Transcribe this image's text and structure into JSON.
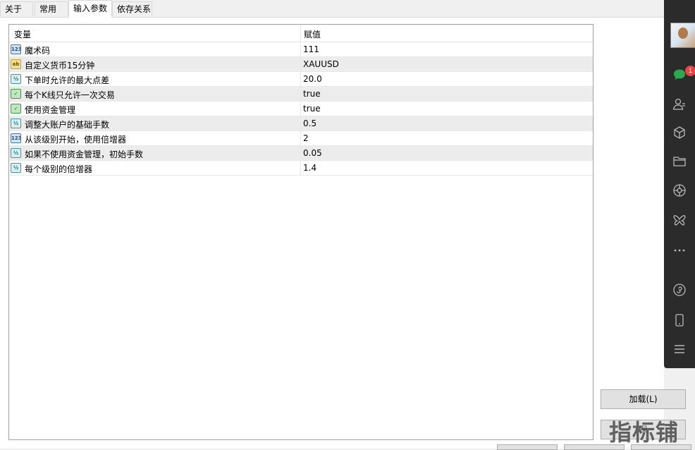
{
  "tabs": [
    {
      "label": "关于",
      "active": false
    },
    {
      "label": "常用",
      "active": false
    },
    {
      "label": "输入参数",
      "active": true
    },
    {
      "label": "依存关系",
      "active": false
    }
  ],
  "table": {
    "headers": {
      "variable": "变量",
      "value": "赋值"
    },
    "rows": [
      {
        "type_icon": "int-icon",
        "icon_text": "123",
        "name": "魔术码",
        "value": "111"
      },
      {
        "type_icon": "string-icon",
        "icon_text": "ab",
        "name": "自定义货币15分钟",
        "value": "XAUUSD"
      },
      {
        "type_icon": "double-icon",
        "icon_text": "½",
        "name": "下单时允许的最大点差",
        "value": "20.0"
      },
      {
        "type_icon": "bool-icon",
        "icon_text": "✓",
        "name": "每个K线只允许一次交易",
        "value": "true"
      },
      {
        "type_icon": "bool-icon",
        "icon_text": "✓",
        "name": "使用资金管理",
        "value": "true"
      },
      {
        "type_icon": "double-icon",
        "icon_text": "½",
        "name": "调整大账户的基础手数",
        "value": "0.5"
      },
      {
        "type_icon": "int-icon",
        "icon_text": "123",
        "name": "从该级别开始，使用倍增器",
        "value": "2"
      },
      {
        "type_icon": "double-icon",
        "icon_text": "½",
        "name": "如果不使用资金管理，初始手数",
        "value": "0.05"
      },
      {
        "type_icon": "double-icon",
        "icon_text": "½",
        "name": "每个级别的倍增器",
        "value": "1.4"
      }
    ]
  },
  "buttons": {
    "load": "加载(L)",
    "reset_partial": "保"
  },
  "watermark": "指标铺",
  "sidebar": {
    "badge_count": "1",
    "icons": [
      "avatar",
      "chat-icon",
      "contacts-icon",
      "cube-icon",
      "folder-icon",
      "aperture-icon",
      "butterfly-icon",
      "more-icon",
      "mini-program-icon",
      "phone-icon",
      "menu-icon"
    ]
  }
}
